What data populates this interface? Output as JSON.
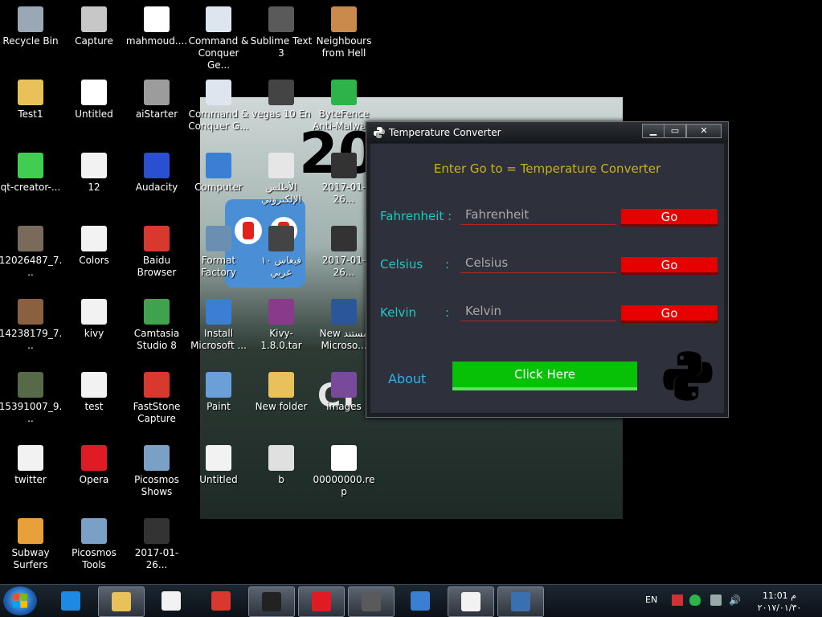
{
  "desktop": {
    "icons": [
      {
        "label": "Recycle Bin",
        "icon": "recycle-bin-icon",
        "color": "#9aa7b5"
      },
      {
        "label": "Capture",
        "icon": "image-icon",
        "color": "#c7c7c7"
      },
      {
        "label": "mahmoud....",
        "icon": "file-icon",
        "color": "#ffffff"
      },
      {
        "label": "Command & Conquer Ge...",
        "icon": "shortcut-icon",
        "color": "#dde6ee"
      },
      {
        "label": "Sublime Text 3",
        "icon": "sublime-icon",
        "color": "#5a5a5a"
      },
      {
        "label": "Neighbours from Hell",
        "icon": "game-icon",
        "color": "#c98a4b"
      },
      {
        "label": "Test1",
        "icon": "folder-icon",
        "color": "#e8c15b"
      },
      {
        "label": "Untitled",
        "icon": "image-icon",
        "color": "#ffffff"
      },
      {
        "label": "aiStarter",
        "icon": "android-icon",
        "color": "#9c9c9c"
      },
      {
        "label": "Command & Conquer G...",
        "icon": "shortcut-icon",
        "color": "#dde6ee"
      },
      {
        "label": "vegas 10 En",
        "icon": "app-icon",
        "color": "#444444"
      },
      {
        "label": "ByteFence Anti-Malwa...",
        "icon": "shield-icon",
        "color": "#2db34a"
      },
      {
        "label": "qt-creator-...",
        "icon": "qt-icon",
        "color": "#41cd52"
      },
      {
        "label": "12",
        "icon": "python-file-icon",
        "color": "#f2f2f2"
      },
      {
        "label": "Audacity",
        "icon": "audacity-icon",
        "color": "#2a4fd1"
      },
      {
        "label": "Computer",
        "icon": "computer-icon",
        "color": "#3a7fd4"
      },
      {
        "label": "الأطلس الإلكتروني",
        "icon": "shortcut-icon",
        "color": "#e6e6e6"
      },
      {
        "label": "2017-01-26...",
        "icon": "video-icon",
        "color": "#333333"
      },
      {
        "label": "12026487_7...",
        "icon": "image-icon",
        "color": "#7a6a5a"
      },
      {
        "label": "Colors",
        "icon": "python-file-icon",
        "color": "#f2f2f2"
      },
      {
        "label": "Baidu Browser",
        "icon": "browser-icon",
        "color": "#d9382f"
      },
      {
        "label": "Format Factory",
        "icon": "shortcut-icon",
        "color": "#6b8fb3"
      },
      {
        "label": "فيغاس ١٠ عربي",
        "icon": "app-icon",
        "color": "#444444"
      },
      {
        "label": "2017-01-26...",
        "icon": "video-icon",
        "color": "#333333"
      },
      {
        "label": "14238179_7...",
        "icon": "image-icon",
        "color": "#8a6040"
      },
      {
        "label": "kivy",
        "icon": "python-file-icon",
        "color": "#f2f2f2"
      },
      {
        "label": "Camtasia Studio 8",
        "icon": "camtasia-icon",
        "color": "#3fa34d"
      },
      {
        "label": "Install Microsoft ...",
        "icon": "installer-icon",
        "color": "#3a7fd4"
      },
      {
        "label": "Kivy-1.8.0.tar",
        "icon": "archive-icon",
        "color": "#8a3a8a"
      },
      {
        "label": "New مستند Microso...",
        "icon": "word-icon",
        "color": "#2b579a"
      },
      {
        "label": "15391007_9...",
        "icon": "image-icon",
        "color": "#566a4a"
      },
      {
        "label": "test",
        "icon": "python-file-icon",
        "color": "#f2f2f2"
      },
      {
        "label": "FastStone Capture",
        "icon": "faststone-icon",
        "color": "#d9382f"
      },
      {
        "label": "Paint",
        "icon": "paint-icon",
        "color": "#6aa0d8"
      },
      {
        "label": "New folder",
        "icon": "folder-icon",
        "color": "#e8c15b"
      },
      {
        "label": "images",
        "icon": "image-icon",
        "color": "#7a4a9a"
      },
      {
        "label": "twitter",
        "icon": "python-file-icon",
        "color": "#f2f2f2"
      },
      {
        "label": "Opera",
        "icon": "opera-icon",
        "color": "#e01b24"
      },
      {
        "label": "Picosmos Shows",
        "icon": "picosmos-icon",
        "color": "#7aa0c8"
      },
      {
        "label": "Untitled",
        "icon": "audio-file-icon",
        "color": "#f2f2f2"
      },
      {
        "label": "b",
        "icon": "image-icon",
        "color": "#e0e0e0"
      },
      {
        "label": "00000000.rep",
        "icon": "file-icon",
        "color": "#ffffff"
      },
      {
        "label": "Subway Surfers",
        "icon": "game-icon",
        "color": "#e8a03a"
      },
      {
        "label": "Picosmos Tools",
        "icon": "picosmos-icon",
        "color": "#7aa0c8"
      },
      {
        "label": "2017-01-26...",
        "icon": "video-icon",
        "color": "#333333"
      }
    ],
    "wallpaper_text": {
      "big": "20",
      "overlay": "CI"
    }
  },
  "window": {
    "title": "Temperature Converter",
    "minimize": "▁",
    "maximize": "▭",
    "close": "✕",
    "heading": "Enter Go to = Temperature Converter",
    "rows": [
      {
        "label": "Fahrenheit :",
        "colon": "",
        "placeholder": "Fahrenheit",
        "button": "Go"
      },
      {
        "label": "Celsius",
        "colon": ":",
        "placeholder": "Celsius",
        "button": "Go"
      },
      {
        "label": "Kelvin",
        "colon": ":",
        "placeholder": "Kelvin",
        "button": "Go"
      }
    ],
    "about": "About",
    "click_here": "Click Here",
    "colors": {
      "accent_heading": "#c9b21c",
      "label": "#20c9c3",
      "go": "#e60000",
      "click": "#07c107",
      "about": "#2ab3f2"
    }
  },
  "taskbar": {
    "language": "EN",
    "time": "11:01 م",
    "date": "٢٠١٧/٠١/٣٠",
    "items": [
      "start-button",
      "internet-explorer-icon",
      "file-explorer-icon",
      "python-icon",
      "baidu-browser-icon",
      "cmd-icon",
      "opera-icon",
      "sublime-icon",
      "keyboard-icon",
      "python-idle-icon",
      "python-tk-icon"
    ]
  }
}
